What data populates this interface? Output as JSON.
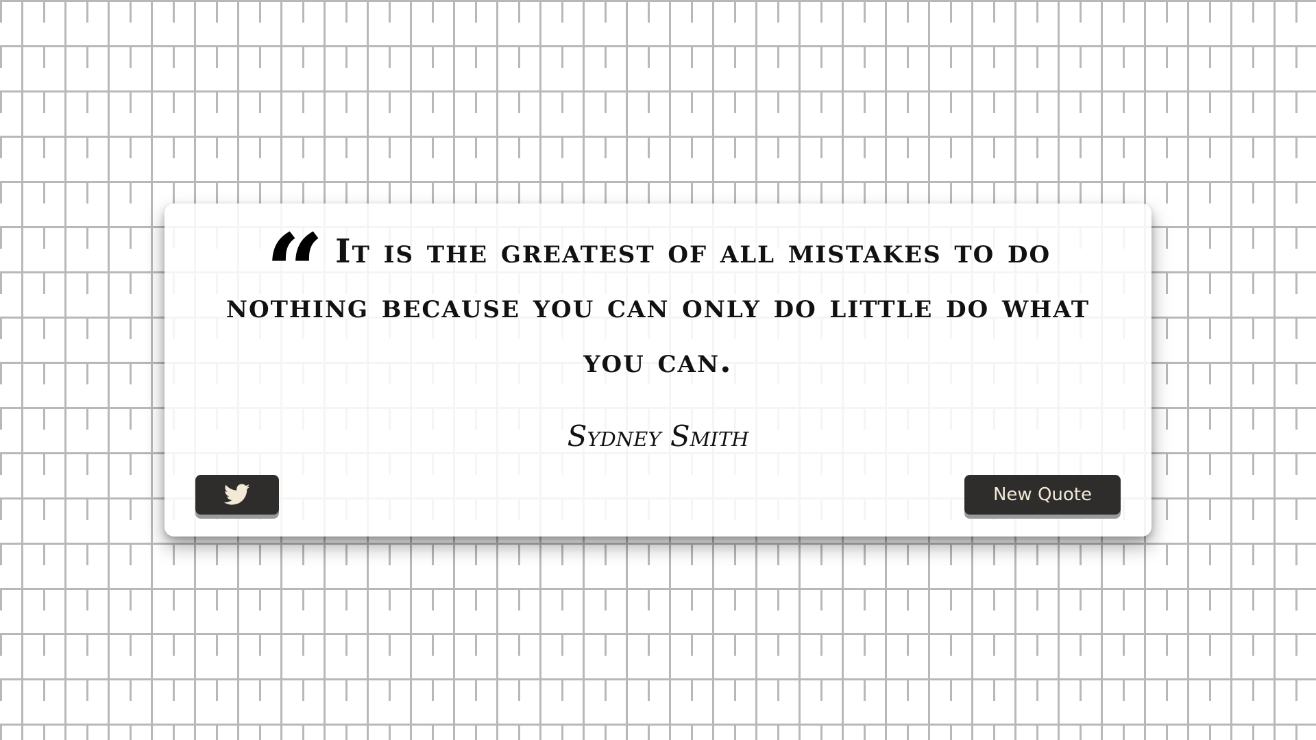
{
  "quote": {
    "mark_glyph": "“",
    "text": "It is the greatest of all mistakes to do nothing because you can only do little do what you can.",
    "author": "Sydney Smith"
  },
  "buttons": {
    "tweet_icon": "twitter-icon",
    "new_quote_label": "New Quote"
  },
  "colors": {
    "button_bg": "#2e2d2c",
    "button_text": "#f2ead6",
    "brick_mortar": "#b8b8b8",
    "text": "#111111"
  }
}
